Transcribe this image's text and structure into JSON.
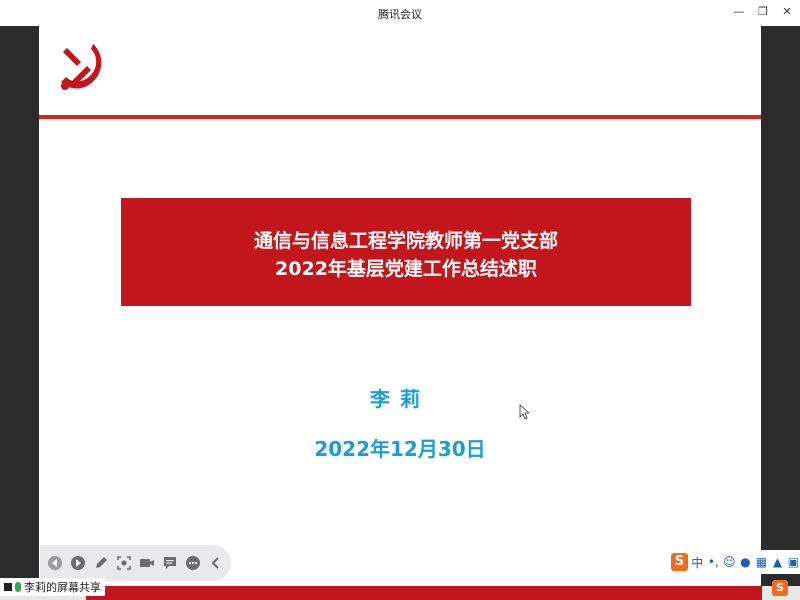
{
  "window": {
    "title": "腾讯会议"
  },
  "slide": {
    "banner_line1": "通信与信息工程学院教师第一党支部",
    "banner_line2": "2022年基层党建工作总结述职",
    "presenter": "李莉",
    "date": "2022年12月30日"
  },
  "toolbar": {
    "items": [
      "previous-icon",
      "next-icon",
      "pen-icon",
      "screenshot-icon",
      "camera-icon",
      "comment-icon",
      "more-icon",
      "collapse-icon"
    ]
  },
  "ime": {
    "logo": "S",
    "mode": "中",
    "punct": "•,",
    "items": [
      "emoji-icon",
      "mic-icon",
      "keyboard-icon",
      "skin-icon",
      "grid-icon"
    ]
  },
  "share": {
    "label": "李莉的屏幕共享"
  },
  "colors": {
    "banner_red": "#c3161c",
    "accent_blue": "#1a9ed8",
    "rule_red": "#d8261f"
  }
}
